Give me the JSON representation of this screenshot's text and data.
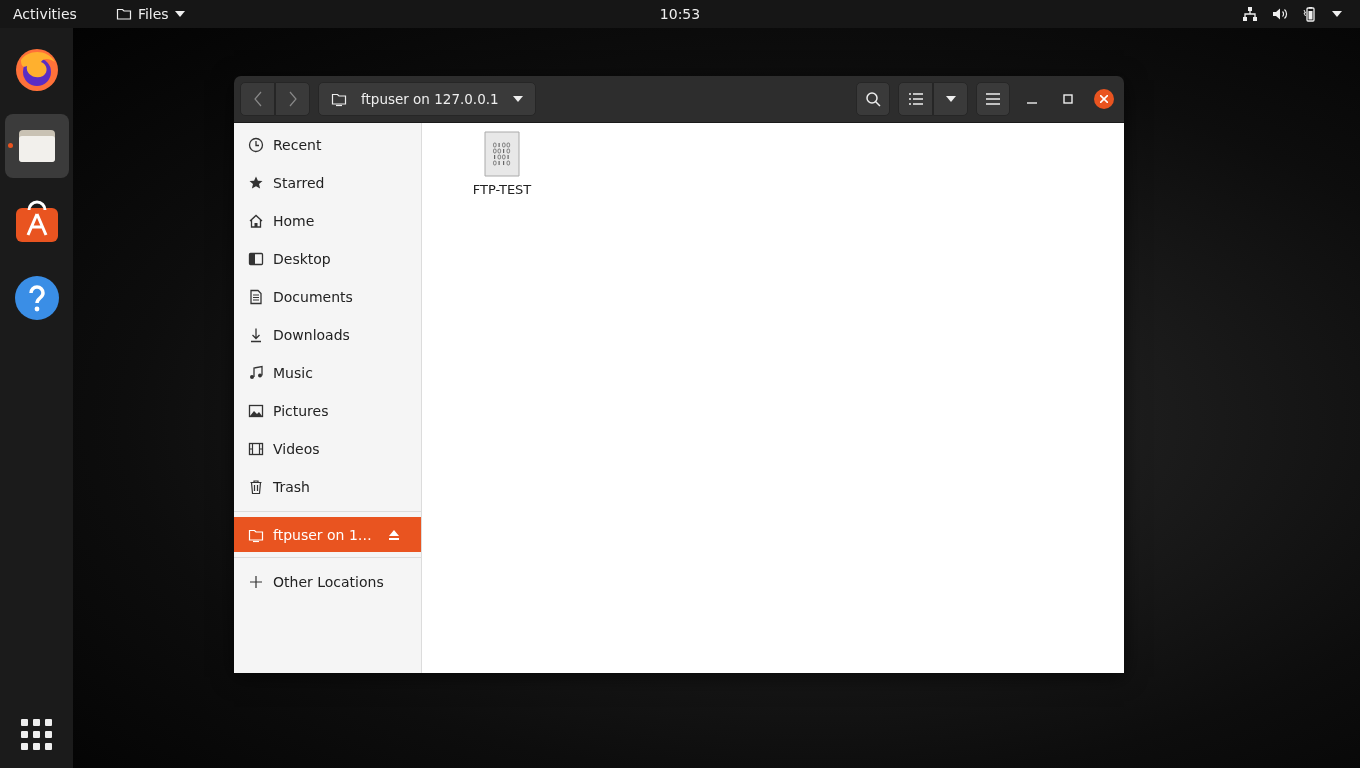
{
  "top_bar": {
    "activities": "Activities",
    "app_menu": "Files",
    "clock": "10:53"
  },
  "dock": [
    {
      "kind": "browser",
      "running": false,
      "selected": false
    },
    {
      "kind": "files",
      "running": true,
      "selected": true
    },
    {
      "kind": "store",
      "running": false,
      "selected": false
    },
    {
      "kind": "help",
      "running": false,
      "selected": false
    }
  ],
  "window": {
    "location": "ftpuser on 127.0.0.1",
    "sidebar": {
      "places": [
        {
          "kind": "recent",
          "label": "Recent",
          "selected": false
        },
        {
          "kind": "starred",
          "label": "Starred",
          "selected": false
        },
        {
          "kind": "home",
          "label": "Home",
          "selected": false
        },
        {
          "kind": "desktop",
          "label": "Desktop",
          "selected": false
        },
        {
          "kind": "documents",
          "label": "Documents",
          "selected": false
        },
        {
          "kind": "downloads",
          "label": "Downloads",
          "selected": false
        },
        {
          "kind": "music",
          "label": "Music",
          "selected": false
        },
        {
          "kind": "pictures",
          "label": "Pictures",
          "selected": false
        },
        {
          "kind": "videos",
          "label": "Videos",
          "selected": false
        },
        {
          "kind": "trash",
          "label": "Trash",
          "selected": false
        }
      ],
      "mounts": [
        {
          "kind": "network",
          "label": "ftpuser on 1…",
          "selected": true,
          "ejectable": true
        }
      ],
      "other": [
        {
          "kind": "add",
          "label": "Other Locations",
          "selected": false
        }
      ]
    },
    "files": [
      {
        "name": "FTP-TEST"
      }
    ]
  }
}
